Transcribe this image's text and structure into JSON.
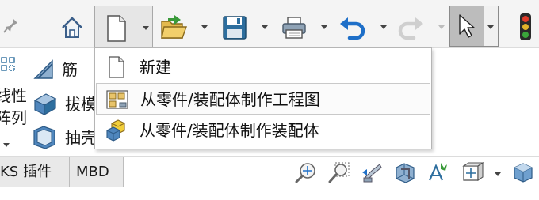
{
  "toolbar": {
    "items": [
      {
        "icon": "pin-icon"
      },
      {
        "icon": "home-icon"
      },
      {
        "icon": "new-document-icon",
        "has_dropdown": true
      },
      {
        "icon": "open-folder-icon",
        "has_dropdown": true
      },
      {
        "icon": "save-icon",
        "has_dropdown": true
      },
      {
        "icon": "print-icon",
        "has_dropdown": true
      },
      {
        "icon": "undo-icon",
        "has_dropdown": true
      },
      {
        "icon": "redo-icon",
        "has_dropdown": true
      },
      {
        "icon": "select-pointer-icon",
        "has_dropdown": true
      },
      {
        "icon": "traffic-light-icon"
      }
    ]
  },
  "ribbon": {
    "left_partial_1": "线性",
    "left_partial_2": "阵列",
    "rib_label": "筋",
    "draft_label": "拔模",
    "shell_label": "抽壳"
  },
  "new_menu": {
    "items": [
      {
        "label": "新建",
        "icon": "blank-document-icon"
      },
      {
        "label": "从零件/装配体制作工程图",
        "icon": "drawing-icon"
      },
      {
        "label": "从零件/装配体制作装配体",
        "icon": "assembly-icon"
      }
    ],
    "hovered_index": 1
  },
  "tabs": {
    "items": [
      {
        "label": "KS 插件"
      },
      {
        "label": "MBD"
      }
    ]
  },
  "view_toolbar": {
    "items": [
      {
        "icon": "zoom-to-fit-icon"
      },
      {
        "icon": "zoom-to-area-icon"
      },
      {
        "icon": "previous-view-icon"
      },
      {
        "icon": "section-view-icon"
      },
      {
        "icon": "dynamic-annotation-icon"
      },
      {
        "icon": "view-orientation-icon",
        "has_dropdown": true
      },
      {
        "icon": "display-style-icon"
      }
    ]
  },
  "colors": {
    "toolbar_bg": "#f4f4f4",
    "menu_border": "#b5b5b5",
    "accent_blue": "#1e6fc8",
    "accent_green": "#3a9a3a"
  }
}
